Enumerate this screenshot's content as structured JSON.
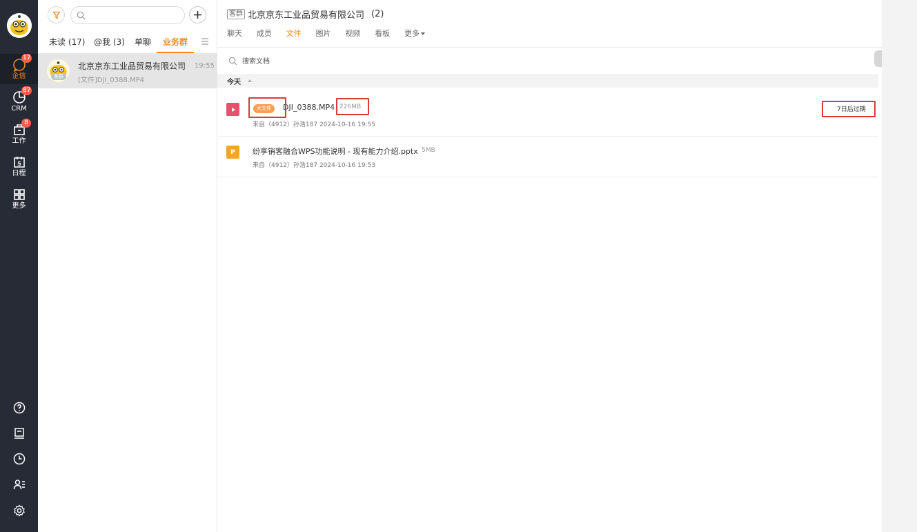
{
  "nav": {
    "items": [
      {
        "label": "企信",
        "badge": "17"
      },
      {
        "label": "CRM",
        "badge": "87"
      },
      {
        "label": "工作",
        "badge": "8"
      },
      {
        "label": "日程",
        "badge": ""
      },
      {
        "label": "更多",
        "badge": ""
      }
    ],
    "calendar_day": "5"
  },
  "conversations": {
    "search_placeholder": "",
    "tabs": [
      {
        "label": "未读 (17)"
      },
      {
        "label": "@我 (3)"
      },
      {
        "label": "单聊"
      },
      {
        "label": "业务群"
      }
    ],
    "items": [
      {
        "name": "北京京东工业品贸易有限公司",
        "time": "19:55",
        "preview": "[文件]DJI_0388.MP4",
        "avatar_tag": "客群"
      }
    ]
  },
  "chat": {
    "group_tag": "客群",
    "title": "北京京东工业品贸易有限公司",
    "member_count": "(2)",
    "tabs": [
      {
        "label": "聊天"
      },
      {
        "label": "成员"
      },
      {
        "label": "文件"
      },
      {
        "label": "图片"
      },
      {
        "label": "视频"
      },
      {
        "label": "看板"
      },
      {
        "label": "更多"
      }
    ],
    "doc_search_placeholder": "搜索文档",
    "section_label": "今天",
    "files": [
      {
        "icon_letter": "",
        "tag": "大文件",
        "name": "DJI_0388.MP4",
        "size": "226MB",
        "meta": "来自（4912）孙浩187  2024-10-16 19:55",
        "expire": "7日后过期"
      },
      {
        "icon_letter": "P",
        "tag": "",
        "name": "纷享销客融合WPS功能说明 - 现有能力介绍.pptx",
        "size": "5MB",
        "meta": "来自（4912）孙浩187  2024-10-16 19:53",
        "expire": ""
      }
    ]
  },
  "colors": {
    "accent": "#f08a24",
    "rail": "#262b36",
    "badge": "#f5604a",
    "highlight": "#d83a3a"
  }
}
